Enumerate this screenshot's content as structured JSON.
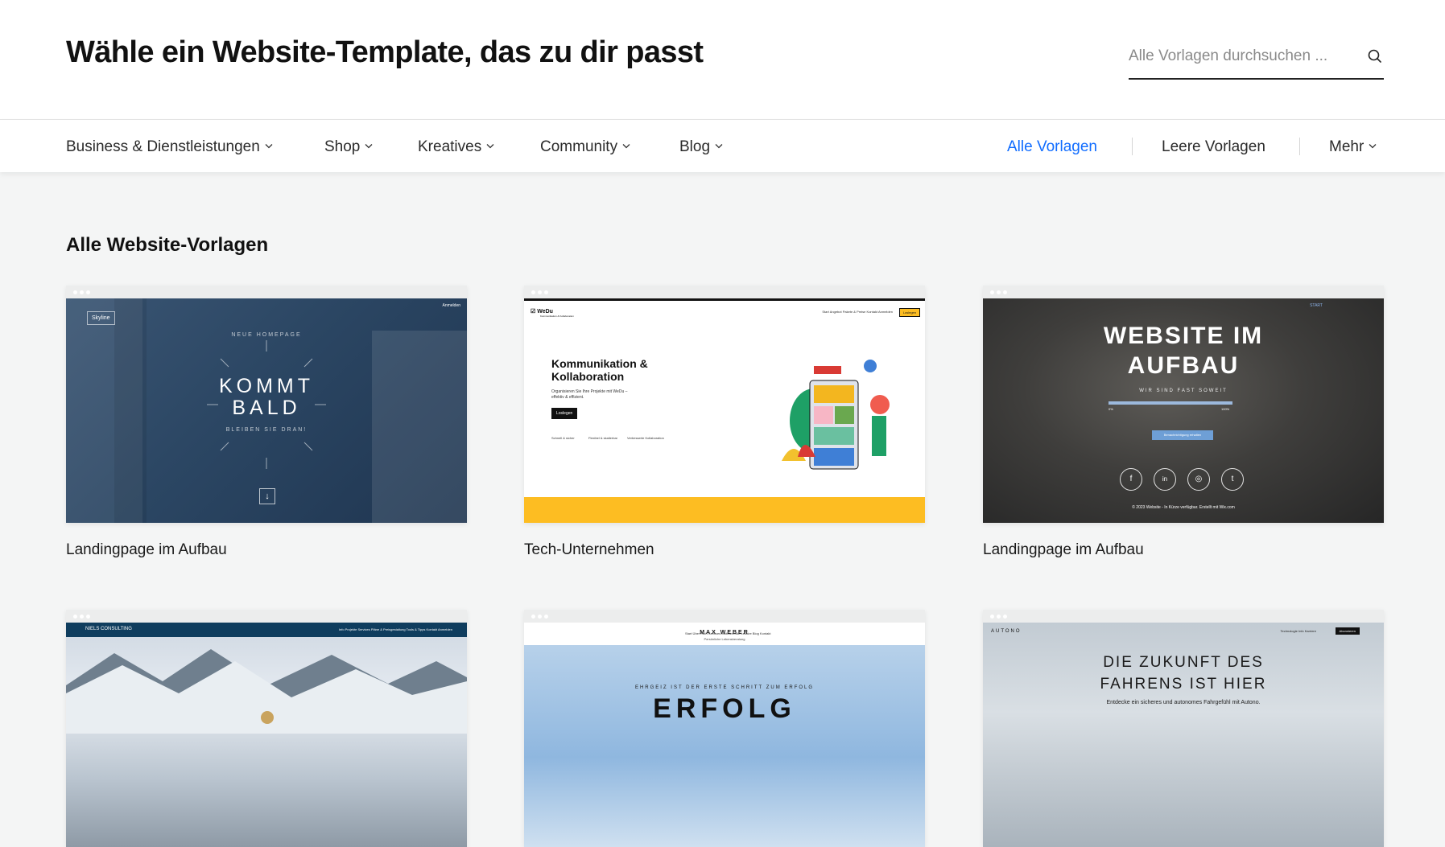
{
  "header": {
    "title": "Wähle ein Website-Template, das zu dir passt",
    "search_placeholder": "Alle Vorlagen durchsuchen ..."
  },
  "nav": {
    "categories": [
      {
        "label": "Business & Dienstleistungen",
        "icon": "chevron-down-icon"
      },
      {
        "label": "Shop",
        "icon": "chevron-down-icon"
      },
      {
        "label": "Kreatives",
        "icon": "chevron-down-icon"
      },
      {
        "label": "Community",
        "icon": "chevron-down-icon"
      },
      {
        "label": "Blog",
        "icon": "chevron-down-icon"
      }
    ],
    "all_templates": "Alle Vorlagen",
    "blank_templates": "Leere Vorlagen",
    "more": "Mehr",
    "active_color": "#116dff"
  },
  "section": {
    "title": "Alle Website-Vorlagen"
  },
  "templates": [
    {
      "label": "Landingpage im Aufbau",
      "preview": {
        "logo": "Skyline",
        "kicker": "NEUE HOMEPAGE",
        "headline_1": "KOMMT",
        "headline_2": "BALD",
        "tagline": "BLEIBEN SIE DRAN!",
        "login": "Anmelden"
      }
    },
    {
      "label": "Tech-Unternehmen",
      "preview": {
        "logo": "WeDu",
        "logo_sub": "Kommunikation & Kollaboration",
        "headline_1": "Kommunikation &",
        "headline_2": "Kollaboration",
        "text": "Organisieren Sie Ihre Projekte mit WeDu – effektiv & effizient.",
        "button": "Loslegen",
        "nav": "Start   Angebot   Pakete & Preise   Kontakt   Anmelden",
        "nav_button": "Loslegen",
        "features": [
          "Schnell & sicher",
          "Flexibel & skalierbar",
          "Verbesserte Kollaboration"
        ],
        "accent_color": "#fdbd22"
      }
    },
    {
      "label": "Landingpage im Aufbau",
      "preview": {
        "headline_1": "WEBSITE IM",
        "headline_2": "AUFBAU",
        "sub": "WIR SIND FAST SOWEIT",
        "progress_start": "0%",
        "progress_end": "100%",
        "button": "Benachrichtigung erhalten",
        "nav": "START",
        "copyright": "© 2023 Website - In Kürze verfügbar. Erstellt mit Wix.com",
        "social": [
          "f",
          "in",
          "◎",
          "t"
        ]
      }
    },
    {
      "label": "",
      "preview": {
        "logo": "NIELS CONSULTING",
        "nav": "Info   Projekte   Services   Pläne & Preisgestaltung   Tools & Tipps   Kontakt   Anmelden"
      }
    },
    {
      "label": "",
      "preview": {
        "name": "MAX WEBER",
        "name_sub": "Persönliche Lebensberatung",
        "nav": "Start   Über mich   Services   Motivierende Lektüre   Blog   Kontakt",
        "sub": "EHRGEIZ IST DER ERSTE SCHRITT ZUM ERFOLG",
        "headline": "ERFOLG"
      }
    },
    {
      "label": "",
      "preview": {
        "logo": "AUTONO",
        "nav": "Technologie   Info   Karriere",
        "nav_button": "Abonnieren",
        "headline_1": "DIE ZUKUNFT DES",
        "headline_2": "FAHRENS IST HIER",
        "sub": "Entdecke ein sicheres und autonomes Fahrgefühl mit Autono."
      }
    }
  ]
}
